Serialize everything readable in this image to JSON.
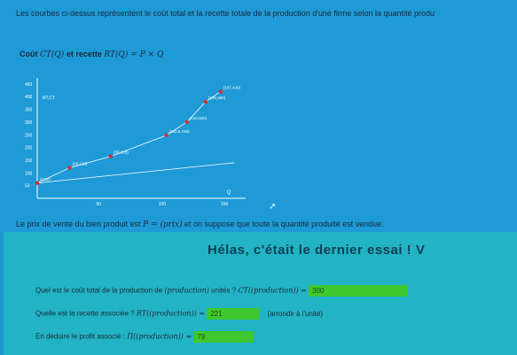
{
  "intro": "Les courbes ci-dessus représentent le coût total et la recette totale de la production d'une firme selon la quantité produ",
  "graph_title": {
    "prefix": "Coût",
    "ct": "CT(Q)",
    "mid": "et recette",
    "rt": "RT(Q) = P × Q"
  },
  "price_sentence": {
    "before": "Le prix de vente du bien produit est",
    "p": "P = (prix)",
    "after": "et on suppose que toute la quantité produite est vendue."
  },
  "banner": "Hélas, c'était le dernier essai ! V",
  "questions": [
    {
      "text": "Quel est le coût total de la production de",
      "bold": "(production)",
      "text2": "unités ?",
      "expr": "CT((production)) =",
      "answer": "300",
      "hint": ""
    },
    {
      "text": "Quelle est la recette associée ?",
      "bold": "",
      "text2": "",
      "expr": "RT((production)) =",
      "answer": "221",
      "hint": "(arrondir à l'unité)"
    },
    {
      "text": "En déduire le profit associé :",
      "bold": "",
      "text2": "",
      "expr": "Π((production)) =",
      "answer": "79",
      "hint": ""
    }
  ],
  "chart_data": {
    "type": "line",
    "ylabel": "RT,CT",
    "xlabel": "Q",
    "y_ticks": [
      "450",
      "400",
      "350",
      "300",
      "250",
      "200",
      "150",
      "100",
      "50"
    ],
    "x_ticks": [
      "50",
      "100",
      "150"
    ],
    "points": [
      {
        "label": "(0,60)",
        "x": 0,
        "y": 60
      },
      {
        "label": "(26,120)",
        "x": 26,
        "y": 120
      },
      {
        "label": "(59,165)",
        "x": 59,
        "y": 165
      },
      {
        "label": "(103.5,248)",
        "x": 103.5,
        "y": 248
      },
      {
        "label": "(120,300)",
        "x": 120,
        "y": 300
      },
      {
        "label": "(135,380)",
        "x": 135,
        "y": 380
      },
      {
        "label": "(147,420)",
        "x": 147,
        "y": 420
      }
    ],
    "colors": {
      "points": "#d63030",
      "curve": "#ffffff"
    }
  }
}
